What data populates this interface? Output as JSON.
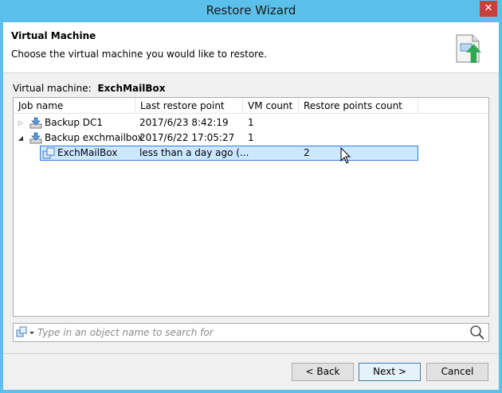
{
  "window": {
    "title": "Restore Wizard",
    "close_glyph": "✕"
  },
  "header": {
    "title": "Virtual Machine",
    "description": "Choose the virtual machine you would like to restore.",
    "icon": "restore-vm-icon"
  },
  "vm_field": {
    "label": "Virtual machine:",
    "value": "ExchMailBox"
  },
  "table": {
    "columns": [
      "Job name",
      "Last restore point",
      "VM count",
      "Restore points count"
    ],
    "rows": [
      {
        "name": "Backup DC1",
        "last": "2017/6/23 8:42:19",
        "vmcount": "1",
        "points": "",
        "expander": "▷",
        "icon": "backup-job-icon"
      },
      {
        "name": "Backup exchmailbox",
        "last": "2017/6/22 17:05:27",
        "vmcount": "1",
        "points": "",
        "expander": "◢",
        "icon": "backup-job-icon"
      },
      {
        "name": "ExchMailBox",
        "last": "less than a day ago (...",
        "vmcount": "",
        "points": "2",
        "expander": "",
        "icon": "vm-icon"
      }
    ]
  },
  "search": {
    "placeholder": "Type in an object name to search for",
    "value": ""
  },
  "buttons": {
    "back": "< Back",
    "next": "Next >",
    "cancel": "Cancel"
  },
  "colors": {
    "titlebar": "#5bc1ec",
    "selection": "#cce8ff",
    "selection_border": "#2f7de1",
    "close": "#c7403a"
  }
}
